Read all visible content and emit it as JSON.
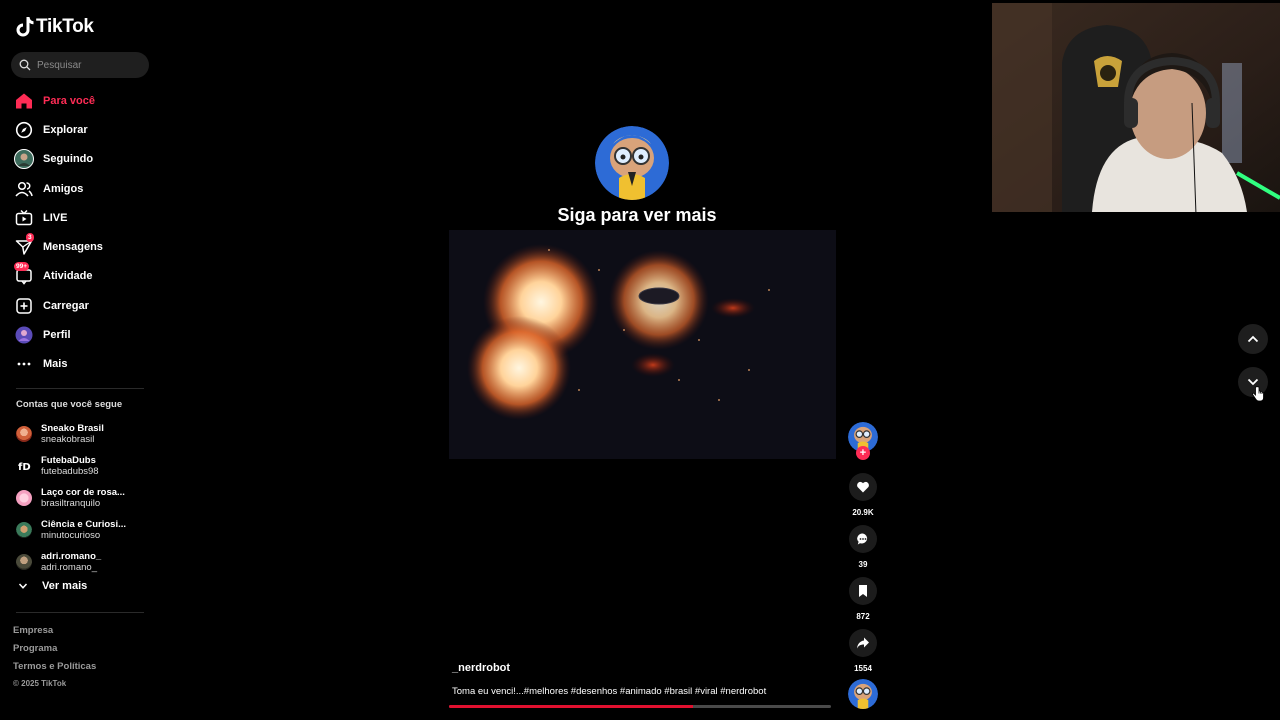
{
  "brand": {
    "name": "TikTok"
  },
  "search": {
    "placeholder": "Pesquisar"
  },
  "nav": [
    {
      "label": "Para você",
      "icon": "home-icon",
      "active": true
    },
    {
      "label": "Explorar",
      "icon": "compass-icon"
    },
    {
      "label": "Seguindo",
      "icon": "following-avatar-icon"
    },
    {
      "label": "Amigos",
      "icon": "friends-icon"
    },
    {
      "label": "LIVE",
      "icon": "live-tv-icon"
    },
    {
      "label": "Mensagens",
      "icon": "paper-plane-icon",
      "badge": "3"
    },
    {
      "label": "Atividade",
      "icon": "activity-icon",
      "badge": "99+"
    },
    {
      "label": "Carregar",
      "icon": "upload-plus-icon"
    },
    {
      "label": "Perfil",
      "icon": "profile-avatar-icon"
    },
    {
      "label": "Mais",
      "icon": "more-dots-icon"
    }
  ],
  "following_section": {
    "title": "Contas que você segue",
    "accounts": [
      {
        "name": "Sneako Brasil",
        "handle": "sneakobrasil"
      },
      {
        "name": "FutebaDubs",
        "handle": "futebadubs98"
      },
      {
        "name": "Laço cor de rosa...",
        "handle": "brasiltranquilo"
      },
      {
        "name": "Ciência e Curiosi...",
        "handle": "minutocurioso"
      },
      {
        "name": "adri.romano_",
        "handle": "adri.romano_"
      }
    ],
    "see_more": "Ver mais"
  },
  "footer": {
    "links": [
      "Empresa",
      "Programa",
      "Termos e Políticas"
    ],
    "copyright": "© 2025 TikTok"
  },
  "video": {
    "overlay_text": "Siga para ver mais",
    "username": "_nerdrobot",
    "description": "Toma eu venci!...#melhores #desenhos #animado #brasil #viral #nerdrobot",
    "progress": 0.64
  },
  "actions": {
    "likes": "20.9K",
    "comments": "39",
    "saves": "872",
    "shares": "1554"
  },
  "colors": {
    "accent": "#fe2c55",
    "progress": "#e1102f",
    "background": "#000000"
  }
}
